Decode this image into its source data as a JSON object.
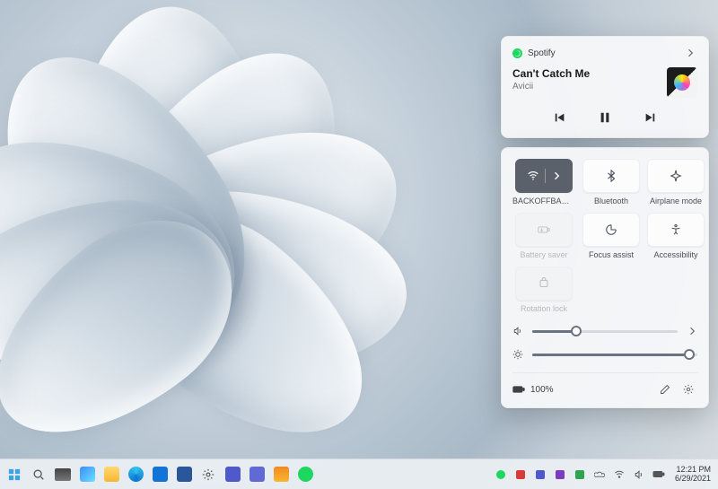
{
  "media": {
    "app_name": "Spotify",
    "track_title": "Can't Catch Me",
    "artist": "Avicii"
  },
  "quick_settings": {
    "tiles": [
      {
        "id": "wifi",
        "label": "BACKOFFBACCHU",
        "state": "active"
      },
      {
        "id": "bluetooth",
        "label": "Bluetooth",
        "state": "normal"
      },
      {
        "id": "airplane",
        "label": "Airplane mode",
        "state": "normal"
      },
      {
        "id": "battery-saver",
        "label": "Battery saver",
        "state": "disabled"
      },
      {
        "id": "focus-assist",
        "label": "Focus assist",
        "state": "normal"
      },
      {
        "id": "accessibility",
        "label": "Accessibility",
        "state": "normal"
      },
      {
        "id": "rotation-lock",
        "label": "Rotation lock",
        "state": "disabled"
      }
    ],
    "volume": {
      "percent": 30
    },
    "brightness": {
      "percent": 95
    },
    "battery_text": "100%"
  },
  "taskbar": {
    "time": "12:21 PM",
    "date": "6/29/2021"
  },
  "colors": {
    "accent": "#5a616b",
    "spotify": "#1ed760"
  }
}
